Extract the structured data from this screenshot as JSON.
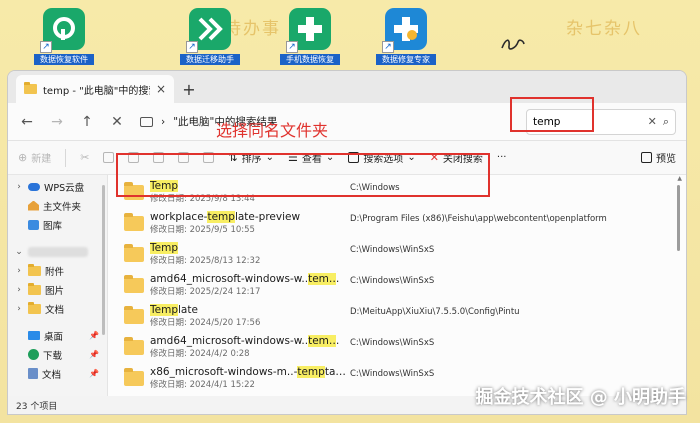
{
  "desktop": {
    "decor_left": "待办事",
    "decor_right": "杂七杂八",
    "icons": [
      {
        "label": "数据恢复软件",
        "color": "#1aa86a"
      },
      {
        "label": "数据迁移助手",
        "color": "#1aa86a"
      },
      {
        "label": "手机数据恢复",
        "color": "#1aa86a"
      },
      {
        "label": "数据修复专家",
        "color": "#1e88d6"
      }
    ]
  },
  "window": {
    "tab_title": "temp - \"此电脑\"中的搜索结果",
    "tab_close": "×",
    "new_tab": "+",
    "path_text": "\"此电脑\"中的搜索结果",
    "search_value": "temp",
    "commands": {
      "new": "新建",
      "sort": "排序",
      "view": "查看",
      "search_options": "搜索选项",
      "close_search": "关闭搜索",
      "more": "···",
      "preview": "预览"
    }
  },
  "sidebar": {
    "items": [
      {
        "label": "WPS云盘"
      },
      {
        "label": "主文件夹"
      },
      {
        "label": "图库"
      },
      {
        "label": "附件"
      },
      {
        "label": "图片"
      },
      {
        "label": "文档"
      },
      {
        "label": "桌面"
      },
      {
        "label": "下载"
      },
      {
        "label": "文档"
      }
    ]
  },
  "files": [
    {
      "pre": "",
      "match": "Temp",
      "post": "",
      "date": "修改日期: 2025/9/8 13:44",
      "path": "C:\\Windows"
    },
    {
      "pre": "workplace-",
      "match": "temp",
      "post": "late-preview",
      "date": "修改日期: 2025/9/5 10:55",
      "path": "D:\\Program Files (x86)\\Feishu\\app\\webcontent\\openplatform"
    },
    {
      "pre": "",
      "match": "Temp",
      "post": "",
      "date": "修改日期: 2025/8/13 12:32",
      "path": "C:\\Windows\\WinSxS"
    },
    {
      "pre": "amd64_microsoft-windows-w..",
      "match": "temp",
      "post": "late-...",
      "date": "修改日期: 2025/2/24 12:17",
      "path": "C:\\Windows\\WinSxS"
    },
    {
      "pre": "",
      "match": "Temp",
      "post": "late",
      "date": "修改日期: 2024/5/20 17:56",
      "path": "D:\\MeituApp\\XiuXiu\\7.5.5.0\\Config\\Pintu"
    },
    {
      "pre": "amd64_microsoft-windows-w..",
      "match": "temp",
      "post": "late-...",
      "date": "修改日期: 2024/4/2 0:28",
      "path": "C:\\Windows\\WinSxS"
    },
    {
      "pre": "x86_microsoft-windows-m..-",
      "match": "temp",
      "post": "table-...",
      "date": "修改日期: 2024/4/1 15:22",
      "path": "C:\\Windows\\WinSxS"
    }
  ],
  "status": {
    "count": "23 个项目"
  },
  "annotation": {
    "text": "选择同名文件夹"
  },
  "watermark": {
    "text": "掘金技术社区 @ 小明助手"
  }
}
